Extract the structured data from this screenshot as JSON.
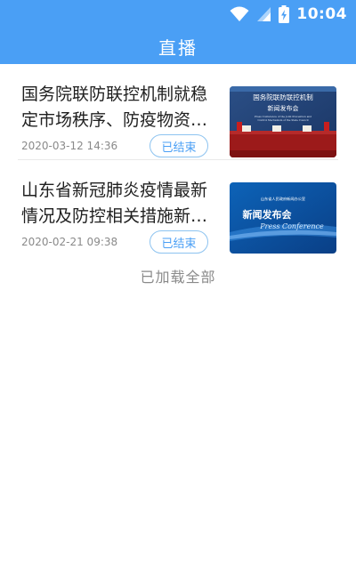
{
  "status_bar": {
    "time": "10:04",
    "icons": [
      "wifi-icon",
      "cellular-signal-icon",
      "battery-charging-icon"
    ]
  },
  "header": {
    "title": "直播"
  },
  "items": [
    {
      "title": "国务院联防联控机制就稳定市场秩序、防疫物资保障情况举行发布会",
      "date": "2020-03-12 14:36",
      "badge": "已结束",
      "thumb_lines": [
        "国务院联防联控机制",
        "新闻发布会",
        "Press Conference of the Joint Prevention and",
        "Control Mechanism of the State Council"
      ]
    },
    {
      "title": "山东省新冠肺炎疫情最新情况及防控相关措施新闻发布会",
      "date": "2020-02-21 09:38",
      "badge": "已结束",
      "thumb_lines": [
        "山东省人民政府新闻办公室",
        "新闻发布会",
        "Press Conference"
      ]
    }
  ],
  "footer": {
    "load_all": "已加载全部"
  },
  "colors": {
    "primary": "#4a9ff5",
    "badge_border": "#8dc3f0",
    "text_primary": "#1f1f1f",
    "text_secondary": "#8a8a8a"
  }
}
